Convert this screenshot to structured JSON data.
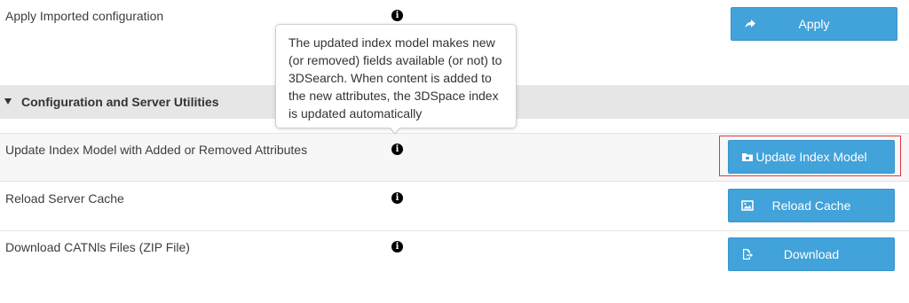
{
  "rows": {
    "apply_import": {
      "label": "Apply Imported configuration",
      "button": "Apply"
    },
    "update_index": {
      "label": "Update Index Model with Added or Removed Attributes",
      "button": "Update Index Model"
    },
    "reload_cache": {
      "label": "Reload Server Cache",
      "button": "Reload Cache"
    },
    "download": {
      "label": "Download CATNls Files (ZIP File)",
      "button": "Download"
    }
  },
  "section": {
    "title": "Configuration and Server Utilities"
  },
  "info_glyph": "i",
  "tooltip": {
    "text": "The updated index model makes new (or removed) fields available (or not) to 3DSearch. When content is added to the new attributes, the 3DSpace index is updated automatically"
  },
  "icons": {
    "apply": "share-arrow-icon",
    "update_index": "folder-icon",
    "reload_cache": "image-icon",
    "download": "file-export-icon",
    "info": "info-icon",
    "section_toggle": "caret-down-icon"
  },
  "colors": {
    "button": "#42a2da",
    "section_bg": "#e6e6e6",
    "row_bg_highlighted": "#f7f7f7",
    "highlight_border": "#e0383e"
  }
}
